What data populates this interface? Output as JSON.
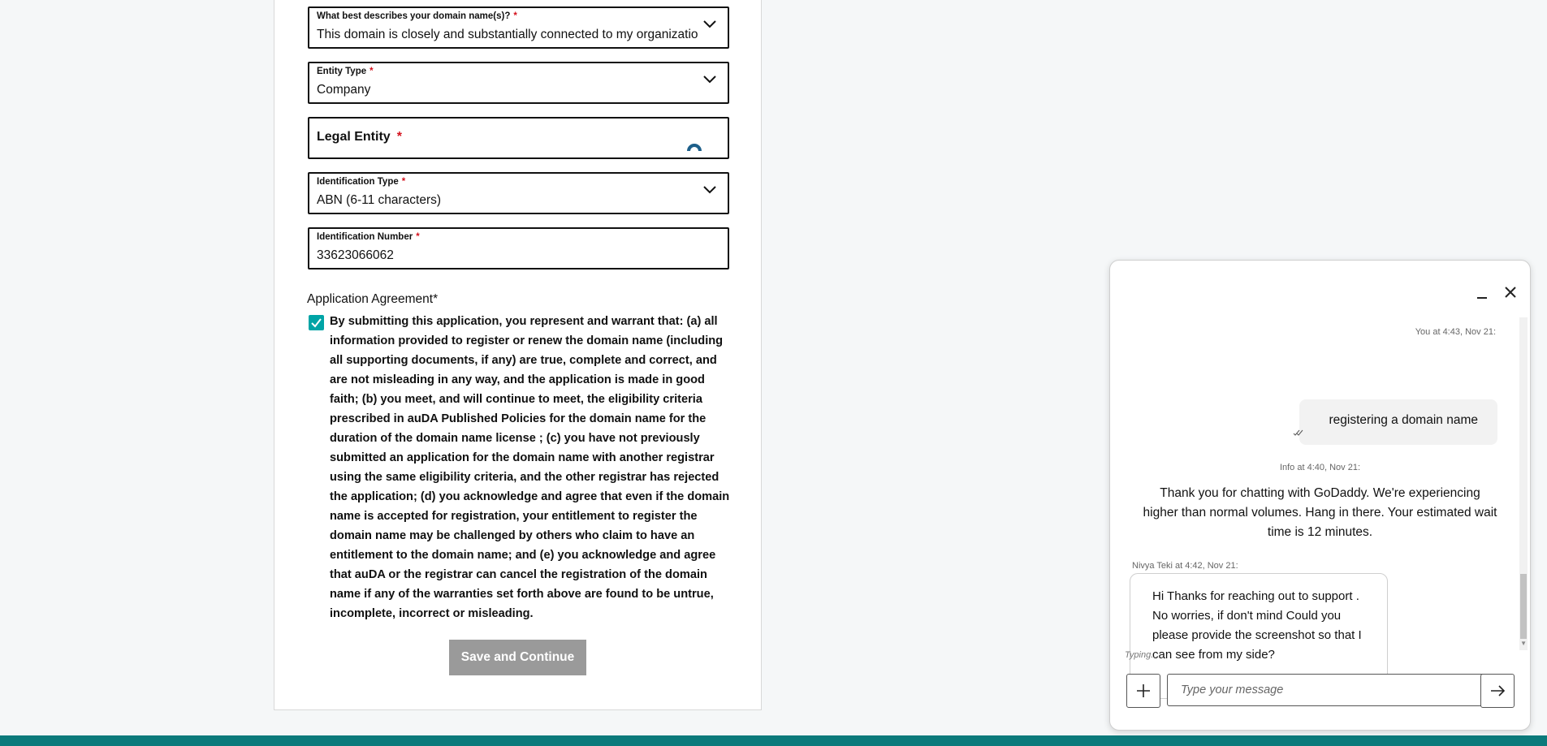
{
  "form": {
    "domain_description": {
      "label": "What best describes your domain name(s)?",
      "required_mark": "*",
      "value": "This domain is closely and substantially connected to my organization"
    },
    "entity_type": {
      "label": "Entity Type",
      "required_mark": "*",
      "value": "Company"
    },
    "legal_entity": {
      "label": "Legal Entity",
      "required_mark": "*"
    },
    "identification_type": {
      "label": "Identification Type",
      "required_mark": "*",
      "value": "ABN (6-11 characters)"
    },
    "identification_number": {
      "label": "Identification Number",
      "required_mark": "*",
      "value": "33623066062"
    },
    "agreement": {
      "title": "Application Agreement*",
      "checked": true,
      "text": "By submitting this application, you represent and warrant that: (a) all information provided to register or renew the domain name (including all supporting documents, if any) are true, complete and correct, and are not misleading in any way, and the application is made in good faith; (b) you meet, and will continue to meet, the eligibility criteria prescribed in auDA Published Policies for the domain name for the duration of the domain name license ; (c) you have not previously submitted an application for the domain name with another registrar using the same eligibility criteria, and the other registrar has rejected the application; (d) you acknowledge and agree that even if the domain name is accepted for registration, your entitlement to register the domain name may be challenged by others who claim to have an entitlement to the domain name; and (e) you acknowledge and agree that auDA or the registrar can cancel the registration of the domain name if any of the warranties set forth above are found to be untrue, incomplete, incorrect or misleading."
    },
    "save_button": "Save and Continue"
  },
  "chat": {
    "messages": {
      "user": {
        "meta": "You at 4:43, Nov 21:",
        "text": "registering a domain name"
      },
      "info": {
        "meta": "Info at 4:40, Nov 21:",
        "text": "Thank you for chatting with GoDaddy. We're experiencing higher than normal volumes. Hang in there. Your estimated wait time is 12 minutes."
      },
      "agent": {
        "meta": "Nivya Teki at 4:42, Nov 21:",
        "text": "Hi Thanks for reaching out to support . No worries, if don't mind Could you please provide the screenshot so that I can see from my side?"
      }
    },
    "typing": "Typing...",
    "input_placeholder": "Type your message"
  },
  "colors": {
    "accent": "#00a4a6",
    "footer": "#0b7a7b",
    "required": "#d4111d",
    "button_disabled": "#9a9a9a"
  },
  "icons": [
    "chevron-down-icon",
    "loading-spinner-icon",
    "checkmark-icon",
    "minimize-icon",
    "close-icon",
    "plus-icon",
    "arrow-right-icon",
    "read-receipt-icon"
  ]
}
